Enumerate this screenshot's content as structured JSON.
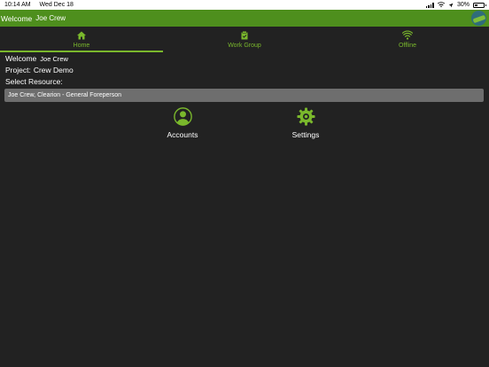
{
  "status_bar": {
    "time": "10:14 AM",
    "date": "Wed Dec 18",
    "battery": "30%"
  },
  "header": {
    "welcome": "Welcome",
    "user_name": "Joe Crew"
  },
  "tabs": [
    {
      "label": "Home",
      "icon": "home-icon",
      "active": true
    },
    {
      "label": "Work Group",
      "icon": "clipboard-icon",
      "active": false
    },
    {
      "label": "Offline",
      "icon": "wifi-icon",
      "active": false
    }
  ],
  "info": {
    "welcome_label": "Welcome",
    "welcome_name": "Joe Crew",
    "project_label": "Project:",
    "project_value": "Crew Demo",
    "select_resource_label": "Select Resource:"
  },
  "resource": {
    "selected": "Joe Crew, Clearion - General Foreperson"
  },
  "tiles": [
    {
      "label": "Accounts",
      "icon": "user-icon"
    },
    {
      "label": "Settings",
      "icon": "gear-icon"
    }
  ],
  "colors": {
    "accent": "#7ab82c",
    "header": "#4e8f1d",
    "background": "#222222",
    "select": "#6e6e6e"
  }
}
